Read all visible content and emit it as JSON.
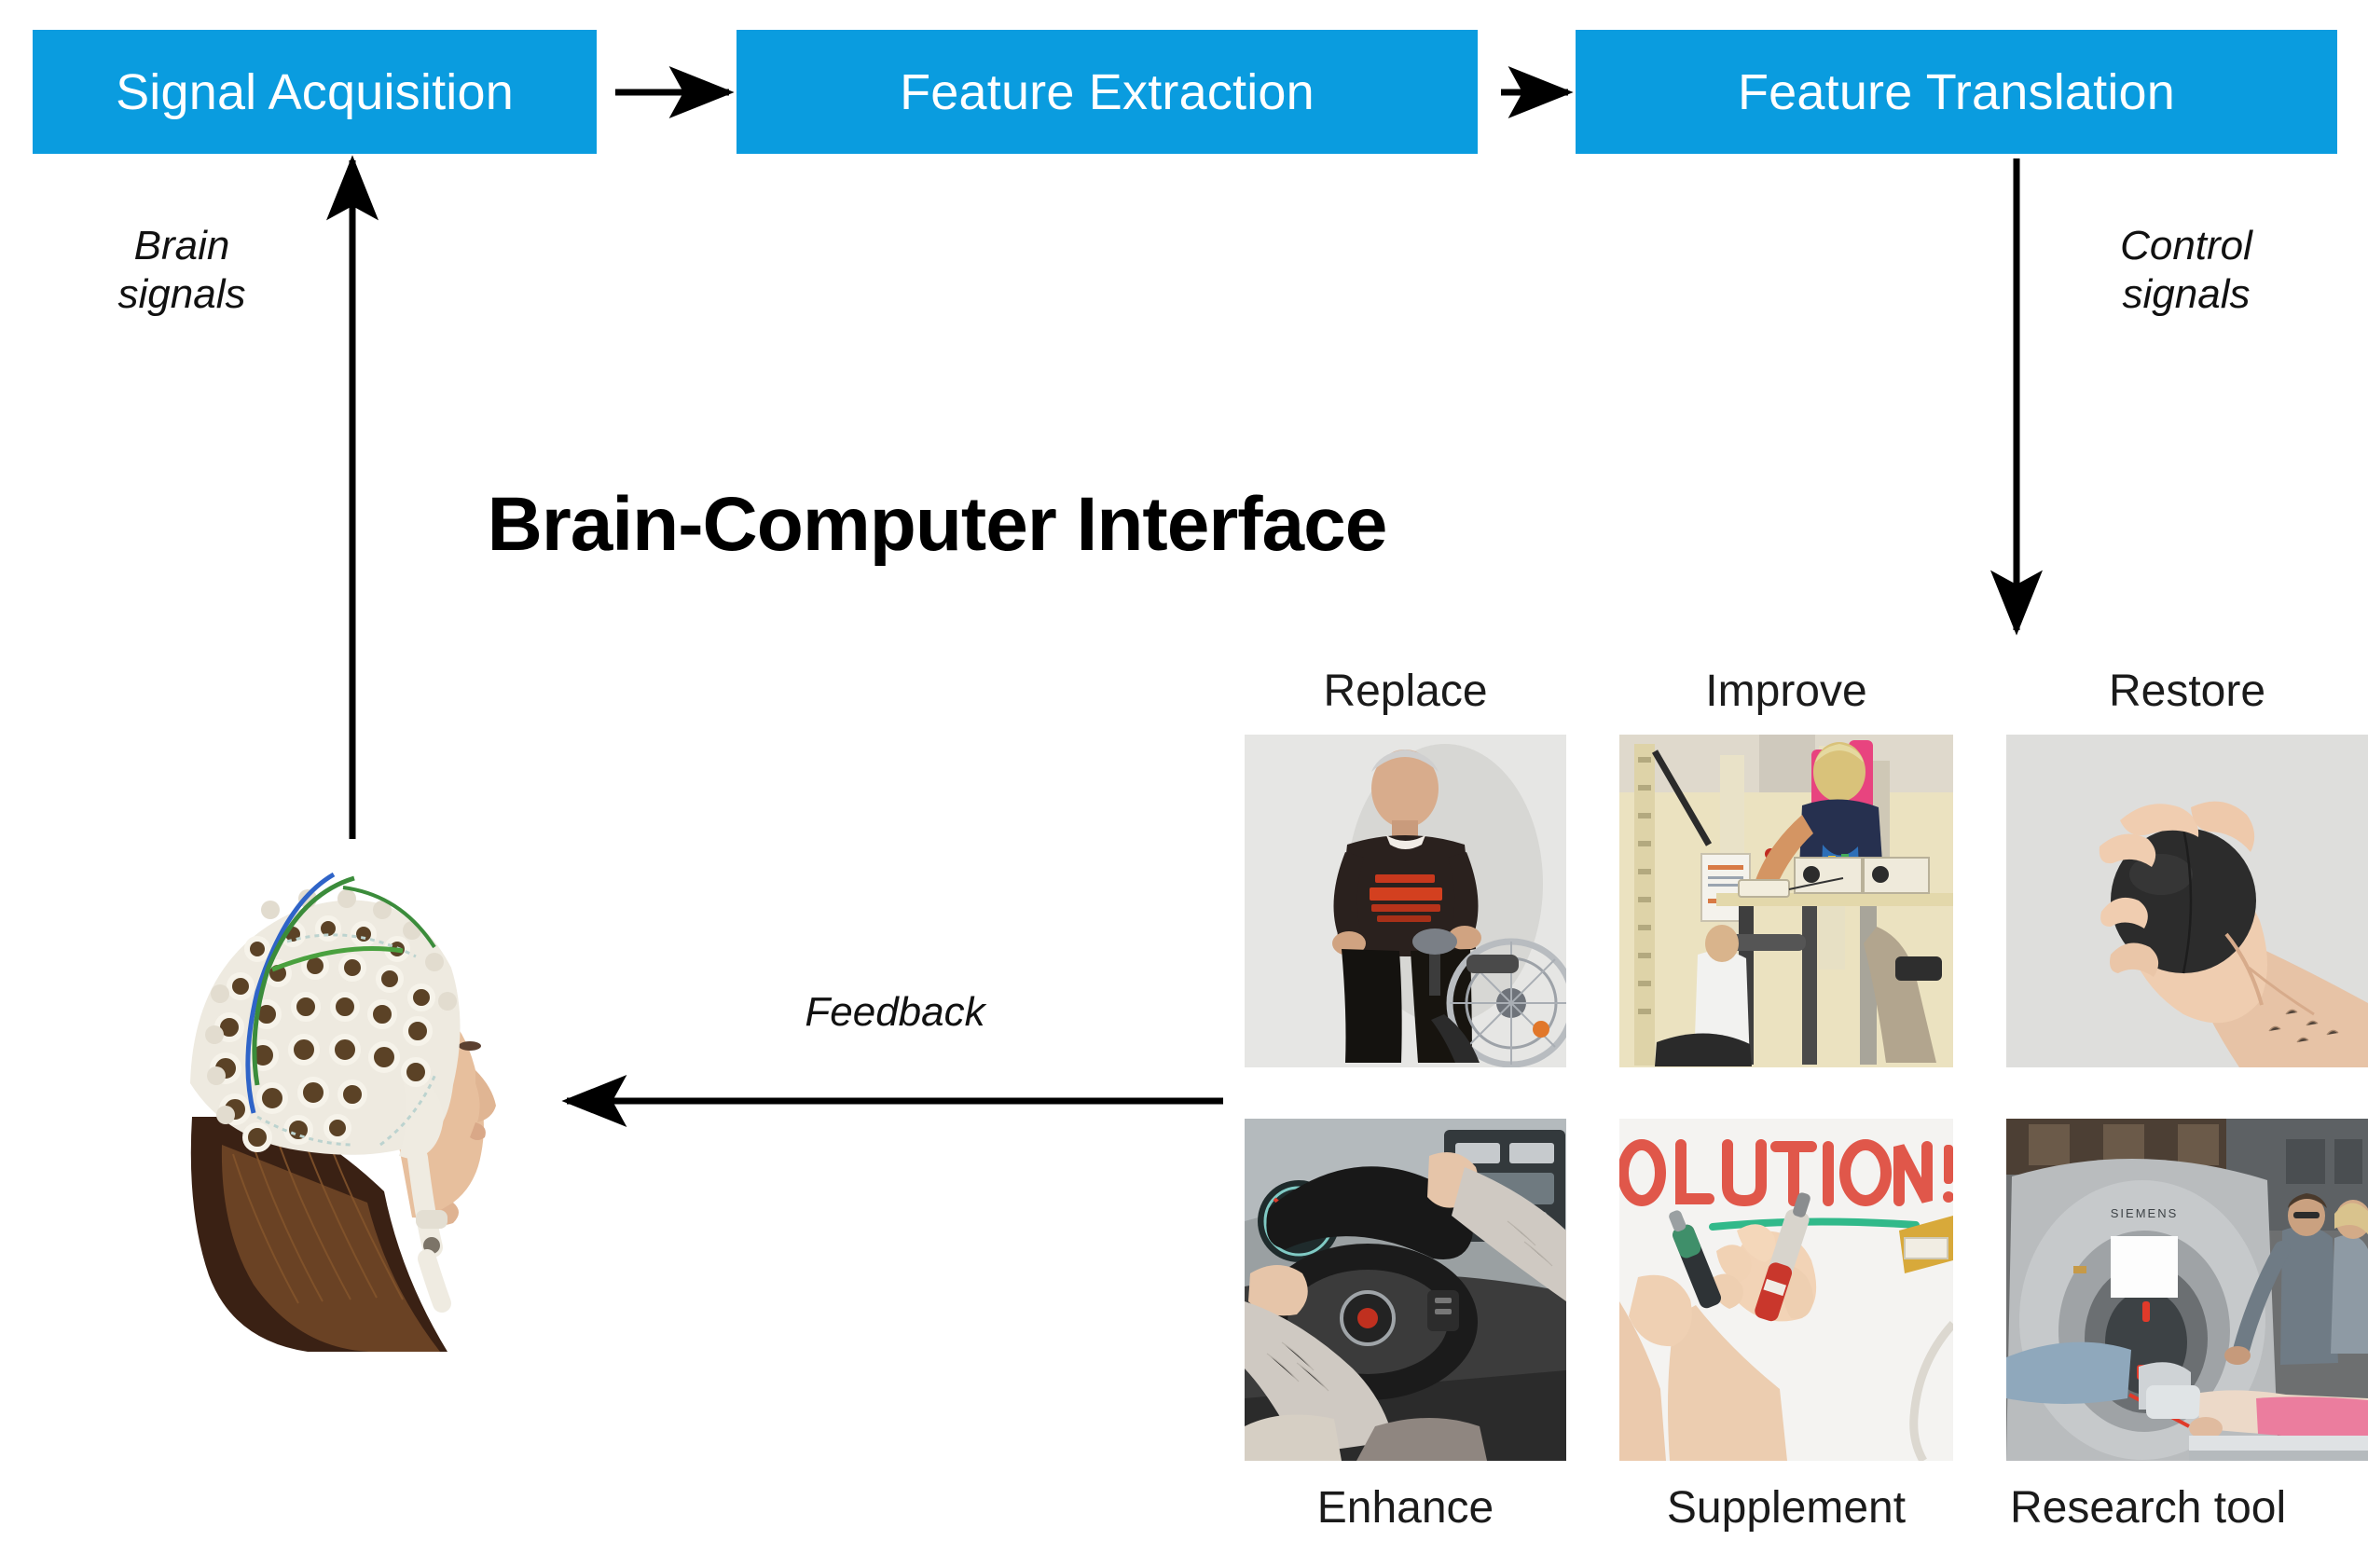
{
  "theme": {
    "accent_blue": "#0a9cdf",
    "arrow_color": "#000000",
    "text_dark": "#111111",
    "background": "#ffffff"
  },
  "pipeline": {
    "stages": [
      {
        "label": "Signal Acquisition"
      },
      {
        "label": "Feature Extraction"
      },
      {
        "label": "Feature Translation"
      }
    ]
  },
  "edges": {
    "brain_signals": "Brain\nsignals",
    "control_signals": "Control\nsignals",
    "feedback": "Feedback"
  },
  "title": {
    "text": "Brain-Computer Interface"
  },
  "applications": {
    "top_row": [
      {
        "label": "Replace",
        "icon": "wheelchair-user-photo"
      },
      {
        "label": "Improve",
        "icon": "gait-rehabilitation-photo"
      },
      {
        "label": "Restore",
        "icon": "hand-gripping-ball-photo"
      }
    ],
    "bottom_row": [
      {
        "label": "Enhance",
        "icon": "driving-steering-wheel-photo"
      },
      {
        "label": "Supplement",
        "icon": "hand-writing-marker-photo"
      },
      {
        "label": "Research tool",
        "icon": "mri-scanner-photo"
      }
    ]
  },
  "subject": {
    "icon": "eeg-cap-head-photo"
  }
}
